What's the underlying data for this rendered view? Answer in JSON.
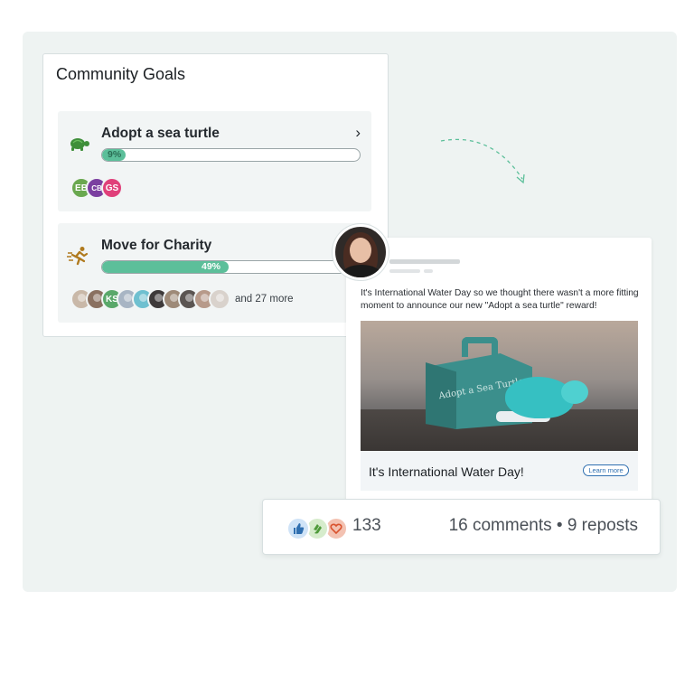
{
  "community_goals": {
    "title": "Community Goals",
    "goals": [
      {
        "name": "Adopt a sea turtle",
        "icon": "turtle-icon",
        "progress_percent": 9,
        "progress_label": "9%",
        "participants": [
          {
            "initials": "EB",
            "color": "#6aa84f"
          },
          {
            "initials": "CB",
            "color": "#7b3fa0"
          },
          {
            "initials": "GS",
            "color": "#e0407a"
          }
        ]
      },
      {
        "name": "Move for Charity",
        "icon": "runner-icon",
        "progress_percent": 49,
        "progress_label": "49%",
        "participants": [
          {
            "initials": "",
            "color": "#c9b8a8"
          },
          {
            "initials": "",
            "color": "#8a7060"
          },
          {
            "initials": "KS",
            "color": "#5aa86a"
          },
          {
            "initials": "",
            "color": "#a8b5c4"
          },
          {
            "initials": "",
            "color": "#6fc0d0"
          },
          {
            "initials": "",
            "color": "#3e3a3a"
          },
          {
            "initials": "",
            "color": "#9e8a78"
          },
          {
            "initials": "",
            "color": "#5b5552"
          },
          {
            "initials": "",
            "color": "#b79a8a"
          },
          {
            "initials": "",
            "color": "#d9d2cc"
          }
        ],
        "more_label": "and 27 more"
      }
    ]
  },
  "post": {
    "text": "It's International Water Day so we thought there wasn't a more fitting moment to announce our new \"Adopt a sea turtle\" reward!",
    "image_box_text": "Adopt a Sea Turtle",
    "cta_title": "It's International Water Day!",
    "cta_button": "Learn more"
  },
  "reactions": {
    "icons": [
      "thumbs-up-icon",
      "clap-icon",
      "heart-icon"
    ],
    "count": "133",
    "comments_reposts": "16 comments • 9 reposts"
  },
  "colors": {
    "progress_fill": "#5cbf9a",
    "turtle_icon": "#3f8f3a",
    "runner_icon": "#b07a1e",
    "link": "#2f6fb0"
  }
}
